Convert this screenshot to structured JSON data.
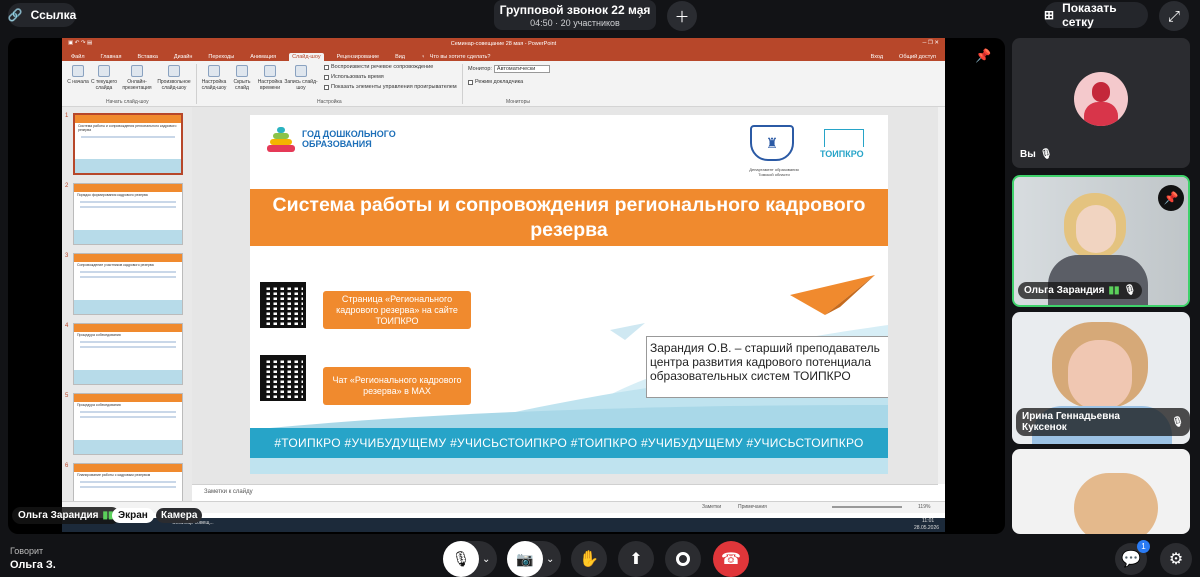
{
  "topbar": {
    "link_label": "Ссылка",
    "call_title": "Групповой звонок 22 мая",
    "call_meta": "04:50 · 20 участников",
    "grid_label": "Показать сетку"
  },
  "presenter": {
    "name": "Ольга Зарандия",
    "tab_screen": "Экран",
    "tab_camera": "Камера"
  },
  "speaking": {
    "label": "Говорит",
    "name": "Ольга З."
  },
  "chat_badge": "1",
  "participants": [
    {
      "name": "Вы"
    },
    {
      "name": "Ольга Зарандия"
    },
    {
      "name": "Ирина Геннадьевна Куксенок"
    }
  ],
  "ppt": {
    "window_title": "Семинар-совещание 28 мая - PowerPoint",
    "tabs": [
      "Файл",
      "Главная",
      "Вставка",
      "Дизайн",
      "Переходы",
      "Анимация",
      "Слайд-шоу",
      "Рецензирование",
      "Вид"
    ],
    "tell_me": "Что вы хотите сделать?",
    "sign_in": "Вход",
    "share": "Общий доступ",
    "ribbon_buttons": [
      "С начала",
      "С текущего слайда",
      "Онлайн-презентация",
      "Произвольное слайд-шоу",
      "Настройка слайд-шоу",
      "Скрыть слайд",
      "Настройка времени",
      "Запись слайд-шоу"
    ],
    "group_start": "Начать слайд-шоу",
    "group_setup": "Настройка",
    "group_monitors": "Мониторы",
    "checks": [
      "Воспроизвести речевое сопровождение",
      "Использовать время",
      "Показать элементы управления проигрывателем"
    ],
    "monitor_label": "Монитор:",
    "monitor_value": "Автоматически",
    "presenter_view": "Режим докладчика",
    "notes_placeholder": "Заметки к слайду",
    "status_notes": "Заметки",
    "status_comments": "Примечания",
    "zoom": "119%",
    "clock_time": "11:01",
    "clock_date": "28.05.2026",
    "taskbar_item": "Семинар-совещ...",
    "thumb_titles": [
      "Система работы и сопровождения регионального кадрового резерва",
      "Порядок формирования кадрового резерва",
      "Сопровождение участников кадрового резерва",
      "Процедура собеседования",
      "Процедура собеседования",
      "Планирование работы с кадровым резервом"
    ]
  },
  "slide": {
    "year_text": "ГОД ДОШКОЛЬНОГО ОБРАЗОВАНИЯ",
    "dept_text": "Департамент образования Томской области",
    "toipkro_logo": "ТОИПКРО",
    "title": "Система работы и сопровождения регионального кадрового резерва",
    "button1": "Страница «Регионального кадрового резерва» на сайте ТОИПКРО",
    "button2": "Чат «Регионального кадрового резерва» в MAX",
    "author": "Зарандия О.В. – старший преподаватель центра развития кадрового потенциала образовательных систем ТОИПКРО",
    "hashtags": "#ТОИПКРО  #УЧИБУДУЩЕМУ  #УЧИСЬСТОИПКРО  #ТОИПКРО  #УЧИБУДУЩЕМУ  #УЧИСЬСТОИПКРО"
  },
  "colors": {
    "accent_orange": "#f08a2e",
    "ppt_red": "#b7472a",
    "hash_blue": "#27a4c8",
    "end_call": "#e0363a"
  }
}
